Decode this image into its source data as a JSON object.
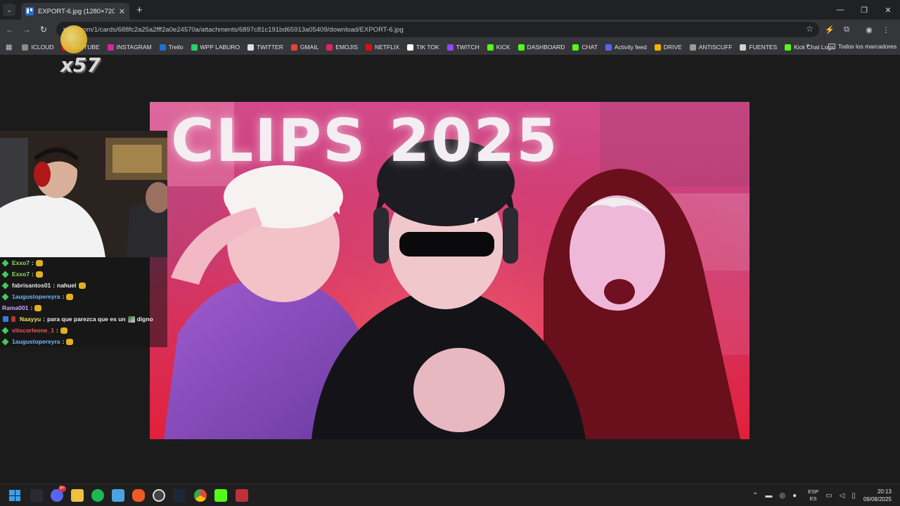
{
  "browser": {
    "tab": {
      "title": "EXPORT-6.jpg (1280×720)",
      "close": "✕"
    },
    "new_tab": "+",
    "window_controls": {
      "minimize": "—",
      "restore": "❐",
      "close": "✕"
    },
    "nav": {
      "back": "←",
      "forward": "→",
      "reload": "↻"
    },
    "url": "trello.com/1/cards/688fc2a25a2fff2a0e24570a/attachments/6897c81c191bd65913a05409/download/EXPORT-6.jpg",
    "star": "☆",
    "bookmarks": [
      {
        "label": "ICLOUD",
        "color": "#8a8a8a"
      },
      {
        "label": "YOUTUBE",
        "color": "#ff0000"
      },
      {
        "label": "INSTAGRAM",
        "color": "#d6249f"
      },
      {
        "label": "Trello",
        "color": "#1f6fd1"
      },
      {
        "label": "WPP LABURO",
        "color": "#25d366"
      },
      {
        "label": "TWITTER",
        "color": "#e0e0e0"
      },
      {
        "label": "GMAIL",
        "color": "#ea4335"
      },
      {
        "label": "EMOJIS",
        "color": "#e0245e"
      },
      {
        "label": "NETFLIX",
        "color": "#e50914"
      },
      {
        "label": "TIK TOK",
        "color": "#ffffff"
      },
      {
        "label": "TWITCH",
        "color": "#9146ff"
      },
      {
        "label": "KICK",
        "color": "#53fc18"
      },
      {
        "label": "DASHBOARD",
        "color": "#53fc18"
      },
      {
        "label": "CHAT",
        "color": "#53fc18"
      },
      {
        "label": "Activity feed",
        "color": "#5865f2"
      },
      {
        "label": "DRIVE",
        "color": "#f4b400"
      },
      {
        "label": "ANTISCUFF",
        "color": "#9a9a9a"
      },
      {
        "label": "FUENTES",
        "color": "#d0d0d0"
      },
      {
        "label": "Kick Chat Logs",
        "color": "#53fc18"
      }
    ],
    "bookmarks_more": "»",
    "all_bookmarks": "Todos los marcadores"
  },
  "overlay": {
    "badge": "x57",
    "chat": [
      {
        "user": "Exxo7",
        "user_color": "#8ee35a",
        "sep": " :",
        "msg": "",
        "icon": "diamond",
        "emote": "coin"
      },
      {
        "user": "Exxo7",
        "user_color": "#8ee35a",
        "sep": " :",
        "msg": "",
        "icon": "diamond",
        "emote": "coin"
      },
      {
        "user": "fabrisantos01",
        "user_color": "#e8e8e8",
        "sep": " :",
        "msg": "nahuel",
        "icon": "diamond",
        "emote": "coin"
      },
      {
        "user": "1augustopereyra",
        "user_color": "#6fb6ff",
        "sep": " :",
        "msg": "",
        "icon": "diamond",
        "emote": "coin"
      },
      {
        "user": "Rama001",
        "user_color": "#c9a6ff",
        "sep": " :",
        "msg": "",
        "icon": "none",
        "emote": "coin"
      },
      {
        "user": "Naayyu",
        "user_color": "#f0e060",
        "sep": " :",
        "msg": "para que parezca que es un",
        "msg2": "digno",
        "icon": "box",
        "emote": "img"
      },
      {
        "user": "vitocorleone_1",
        "user_color": "#ff5050",
        "sep": " :",
        "msg": "",
        "icon": "diamond",
        "emote": "coin"
      },
      {
        "user": "1augustopereyra",
        "user_color": "#6fb6ff",
        "sep": " :",
        "msg": "",
        "icon": "diamond",
        "emote": "coin"
      }
    ]
  },
  "image": {
    "title": "CLIPS 2025"
  },
  "taskbar": {
    "apps": [
      "windows",
      "widgets",
      "discord",
      "file-explorer",
      "spotify",
      "notepad",
      "brave",
      "obs",
      "steam",
      "chrome",
      "kick",
      "mail"
    ],
    "discord_badge": "9+",
    "tray": {
      "chevron": "⌃",
      "lang_top": "ESP",
      "lang_bottom": "ES"
    },
    "time": "20:13",
    "date": "09/08/2025"
  }
}
